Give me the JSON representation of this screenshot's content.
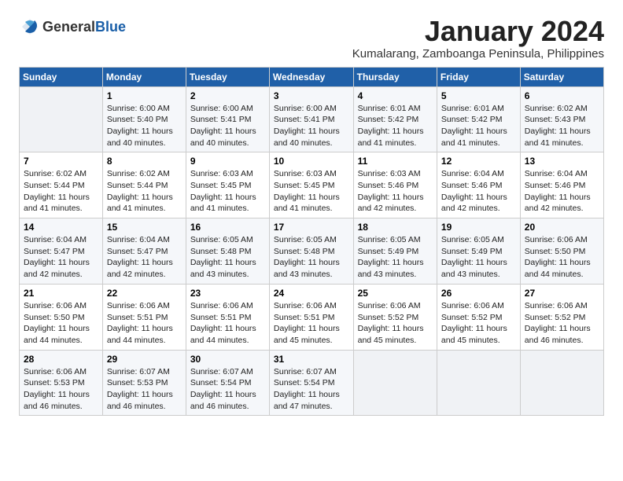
{
  "logo": {
    "general": "General",
    "blue": "Blue"
  },
  "title": "January 2024",
  "subtitle": "Kumalarang, Zamboanga Peninsula, Philippines",
  "days_header": [
    "Sunday",
    "Monday",
    "Tuesday",
    "Wednesday",
    "Thursday",
    "Friday",
    "Saturday"
  ],
  "weeks": [
    [
      {
        "day": "",
        "info": ""
      },
      {
        "day": "1",
        "info": "Sunrise: 6:00 AM\nSunset: 5:40 PM\nDaylight: 11 hours\nand 40 minutes."
      },
      {
        "day": "2",
        "info": "Sunrise: 6:00 AM\nSunset: 5:41 PM\nDaylight: 11 hours\nand 40 minutes."
      },
      {
        "day": "3",
        "info": "Sunrise: 6:00 AM\nSunset: 5:41 PM\nDaylight: 11 hours\nand 40 minutes."
      },
      {
        "day": "4",
        "info": "Sunrise: 6:01 AM\nSunset: 5:42 PM\nDaylight: 11 hours\nand 41 minutes."
      },
      {
        "day": "5",
        "info": "Sunrise: 6:01 AM\nSunset: 5:42 PM\nDaylight: 11 hours\nand 41 minutes."
      },
      {
        "day": "6",
        "info": "Sunrise: 6:02 AM\nSunset: 5:43 PM\nDaylight: 11 hours\nand 41 minutes."
      }
    ],
    [
      {
        "day": "7",
        "info": "Sunrise: 6:02 AM\nSunset: 5:44 PM\nDaylight: 11 hours\nand 41 minutes."
      },
      {
        "day": "8",
        "info": "Sunrise: 6:02 AM\nSunset: 5:44 PM\nDaylight: 11 hours\nand 41 minutes."
      },
      {
        "day": "9",
        "info": "Sunrise: 6:03 AM\nSunset: 5:45 PM\nDaylight: 11 hours\nand 41 minutes."
      },
      {
        "day": "10",
        "info": "Sunrise: 6:03 AM\nSunset: 5:45 PM\nDaylight: 11 hours\nand 41 minutes."
      },
      {
        "day": "11",
        "info": "Sunrise: 6:03 AM\nSunset: 5:46 PM\nDaylight: 11 hours\nand 42 minutes."
      },
      {
        "day": "12",
        "info": "Sunrise: 6:04 AM\nSunset: 5:46 PM\nDaylight: 11 hours\nand 42 minutes."
      },
      {
        "day": "13",
        "info": "Sunrise: 6:04 AM\nSunset: 5:46 PM\nDaylight: 11 hours\nand 42 minutes."
      }
    ],
    [
      {
        "day": "14",
        "info": "Sunrise: 6:04 AM\nSunset: 5:47 PM\nDaylight: 11 hours\nand 42 minutes."
      },
      {
        "day": "15",
        "info": "Sunrise: 6:04 AM\nSunset: 5:47 PM\nDaylight: 11 hours\nand 42 minutes."
      },
      {
        "day": "16",
        "info": "Sunrise: 6:05 AM\nSunset: 5:48 PM\nDaylight: 11 hours\nand 43 minutes."
      },
      {
        "day": "17",
        "info": "Sunrise: 6:05 AM\nSunset: 5:48 PM\nDaylight: 11 hours\nand 43 minutes."
      },
      {
        "day": "18",
        "info": "Sunrise: 6:05 AM\nSunset: 5:49 PM\nDaylight: 11 hours\nand 43 minutes."
      },
      {
        "day": "19",
        "info": "Sunrise: 6:05 AM\nSunset: 5:49 PM\nDaylight: 11 hours\nand 43 minutes."
      },
      {
        "day": "20",
        "info": "Sunrise: 6:06 AM\nSunset: 5:50 PM\nDaylight: 11 hours\nand 44 minutes."
      }
    ],
    [
      {
        "day": "21",
        "info": "Sunrise: 6:06 AM\nSunset: 5:50 PM\nDaylight: 11 hours\nand 44 minutes."
      },
      {
        "day": "22",
        "info": "Sunrise: 6:06 AM\nSunset: 5:51 PM\nDaylight: 11 hours\nand 44 minutes."
      },
      {
        "day": "23",
        "info": "Sunrise: 6:06 AM\nSunset: 5:51 PM\nDaylight: 11 hours\nand 44 minutes."
      },
      {
        "day": "24",
        "info": "Sunrise: 6:06 AM\nSunset: 5:51 PM\nDaylight: 11 hours\nand 45 minutes."
      },
      {
        "day": "25",
        "info": "Sunrise: 6:06 AM\nSunset: 5:52 PM\nDaylight: 11 hours\nand 45 minutes."
      },
      {
        "day": "26",
        "info": "Sunrise: 6:06 AM\nSunset: 5:52 PM\nDaylight: 11 hours\nand 45 minutes."
      },
      {
        "day": "27",
        "info": "Sunrise: 6:06 AM\nSunset: 5:52 PM\nDaylight: 11 hours\nand 46 minutes."
      }
    ],
    [
      {
        "day": "28",
        "info": "Sunrise: 6:06 AM\nSunset: 5:53 PM\nDaylight: 11 hours\nand 46 minutes."
      },
      {
        "day": "29",
        "info": "Sunrise: 6:07 AM\nSunset: 5:53 PM\nDaylight: 11 hours\nand 46 minutes."
      },
      {
        "day": "30",
        "info": "Sunrise: 6:07 AM\nSunset: 5:54 PM\nDaylight: 11 hours\nand 46 minutes."
      },
      {
        "day": "31",
        "info": "Sunrise: 6:07 AM\nSunset: 5:54 PM\nDaylight: 11 hours\nand 47 minutes."
      },
      {
        "day": "",
        "info": ""
      },
      {
        "day": "",
        "info": ""
      },
      {
        "day": "",
        "info": ""
      }
    ]
  ]
}
